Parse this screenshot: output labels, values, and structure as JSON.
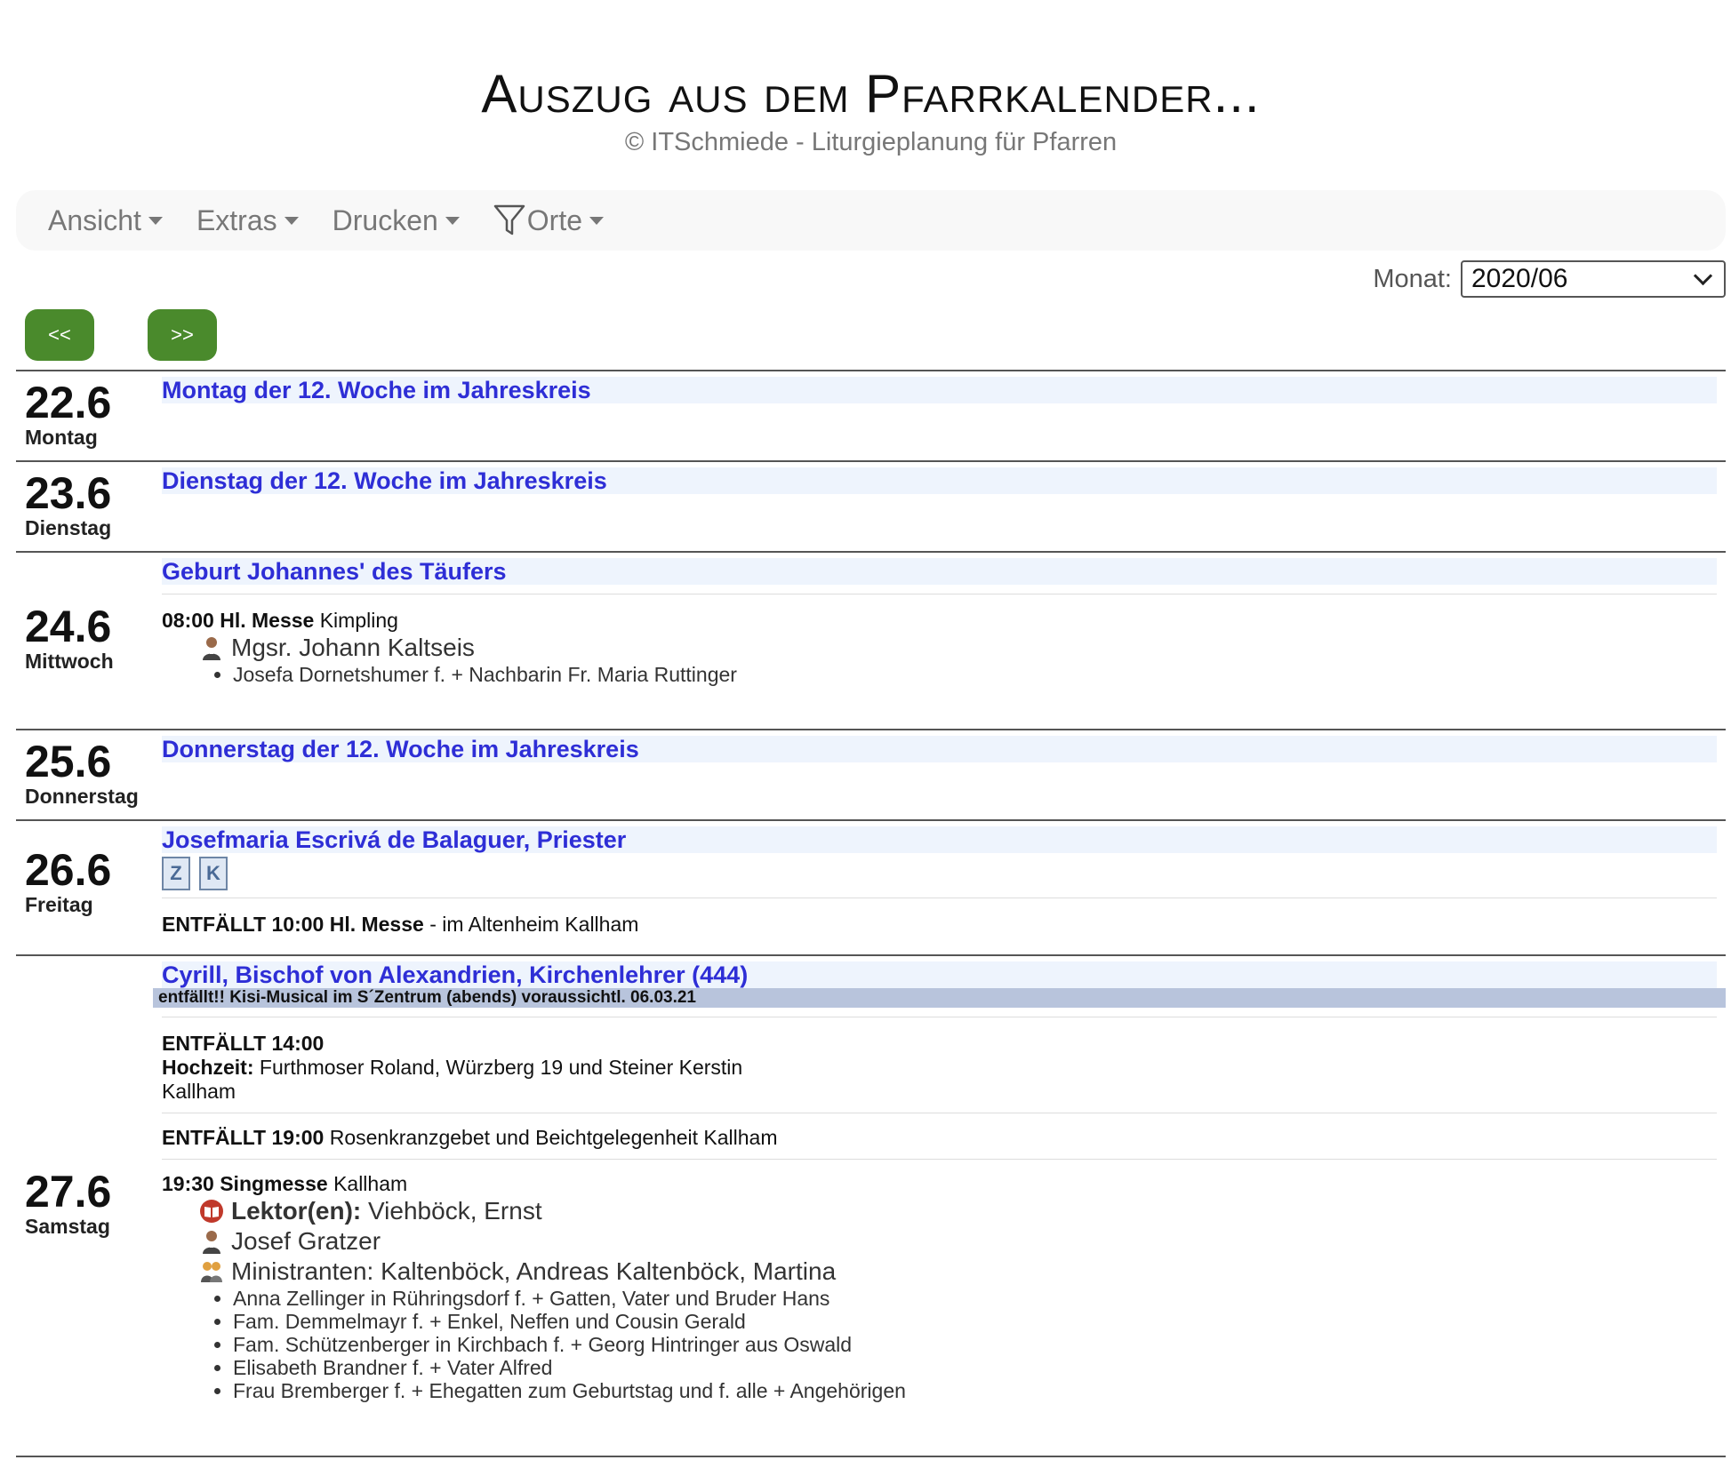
{
  "header": {
    "title": "Auszug aus dem Pfarrkalender...",
    "subtitle": "© ITSchmiede - Liturgieplanung für Pfarren"
  },
  "nav": {
    "items": [
      {
        "label": "Ansicht"
      },
      {
        "label": "Extras"
      },
      {
        "label": "Drucken"
      },
      {
        "label": "Orte"
      }
    ]
  },
  "month": {
    "label": "Monat:",
    "value": "2020/06"
  },
  "buttons": {
    "prev": "<<",
    "next": ">>"
  },
  "days": [
    {
      "date": "22.6",
      "weekday": "Montag",
      "feast": "Montag der 12. Woche im Jahreskreis"
    },
    {
      "date": "23.6",
      "weekday": "Dienstag",
      "feast": "Dienstag der 12. Woche im Jahreskreis"
    },
    {
      "date": "24.6",
      "weekday": "Mittwoch",
      "feast": "Geburt Johannes' des Täufers",
      "event1": {
        "time": "08:00",
        "type": "Hl. Messe",
        "place": "Kimpling",
        "person": "Mgsr. Johann Kaltseis",
        "intentions": [
          "Josefa Dornetshumer f. + Nachbarin Fr. Maria Ruttinger"
        ]
      }
    },
    {
      "date": "25.6",
      "weekday": "Donnerstag",
      "feast": "Donnerstag der 12. Woche im Jahreskreis"
    },
    {
      "date": "26.6",
      "weekday": "Freitag",
      "feast": "Josefmaria Escrivá de Balaguer, Priester",
      "icons": [
        "Z",
        "K"
      ],
      "event1": {
        "prefix": "ENTFÄLLT 10:00 Hl. Messe",
        "text": " - im Altenheim Kallham"
      }
    },
    {
      "date": "27.6",
      "weekday": "Samstag",
      "feast": "Cyrill, Bischof von Alexandrien, Kirchenlehrer (444)",
      "notice": "entfällt!! Kisi-Musical im S´Zentrum (abends) voraussichtl. 06.03.21",
      "event1": {
        "line1": "ENTFÄLLT 14:00",
        "label": "Hochzeit:",
        "text": " Furthmoser Roland, Würzberg 19 und Steiner Kerstin",
        "place": "Kallham"
      },
      "event2": {
        "prefix": "ENTFÄLLT 19:00",
        "text": " Rosenkranzgebet und Beichtgelegenheit Kallham"
      },
      "event3": {
        "time": "19:30",
        "type": "Singmesse",
        "place": "Kallham",
        "lector_label": "Lektor(en):",
        "lector": " Viehböck, Ernst",
        "person": "Josef Gratzer",
        "ministranten": "Ministranten: Kaltenböck, Andreas Kaltenböck, Martina",
        "intentions": [
          "Anna Zellinger in Rühringsdorf f. + Gatten, Vater und Bruder Hans",
          "Fam. Demmelmayr f. + Enkel, Neffen und Cousin Gerald",
          "Fam. Schützenberger in Kirchbach f. + Georg Hintringer aus Oswald",
          "Elisabeth Brandner f. + Vater Alfred",
          "Frau Bremberger f. + Ehegatten zum Geburtstag und f. alle + Angehörigen"
        ]
      }
    }
  ]
}
